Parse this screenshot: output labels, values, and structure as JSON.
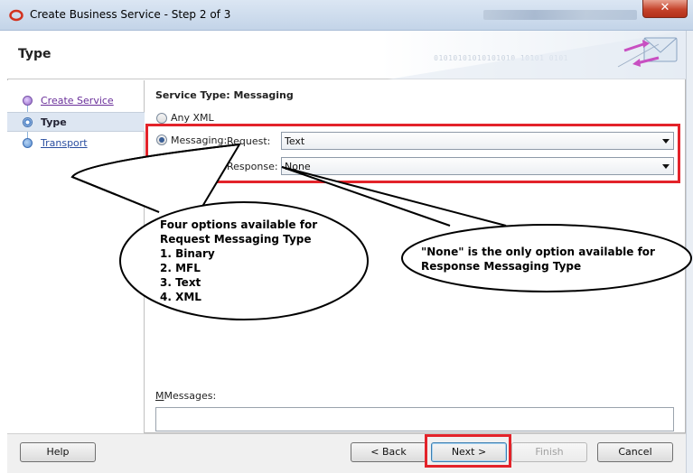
{
  "window": {
    "title": "Create Business Service - Step 2 of 3",
    "close_label": "✕"
  },
  "header": {
    "title": "Type",
    "binary_text": "01010101010101010 10101 0101"
  },
  "nav": {
    "items": [
      {
        "label": "Create Service",
        "state": "done"
      },
      {
        "label": "Type",
        "state": "current"
      },
      {
        "label": "Transport",
        "state": "todo"
      }
    ]
  },
  "main": {
    "section_label": "Service Type: Messaging",
    "option_any_xml": "Any XML",
    "option_messaging": "Messaging:",
    "request_label": "Request:",
    "request_value": "Text",
    "response_label": "Response:",
    "response_value": "None",
    "messages_label": "Messages:",
    "messages_value": ""
  },
  "annotations": {
    "left_callout": "Four options available for\nRequest Messaging Type\n1. Binary\n2. MFL\n3. Text\n4. XML",
    "right_callout": "\"None\" is the only option available for\nResponse Messaging Type"
  },
  "footer": {
    "help": "Help",
    "back": "< Back",
    "next": "Next >",
    "finish": "Finish",
    "cancel": "Cancel"
  },
  "colors": {
    "highlight_red": "#e3232a",
    "nav_active_bg": "#dde6f2"
  }
}
